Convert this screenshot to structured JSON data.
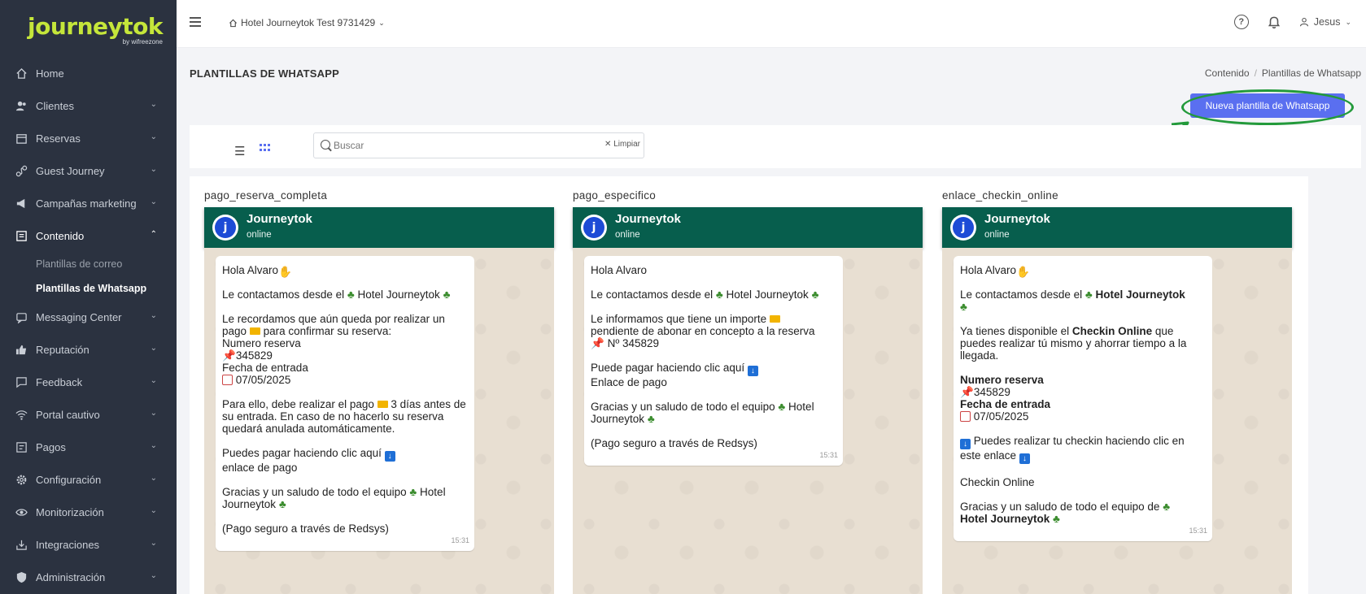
{
  "sidebar": {
    "logo": "journeytok",
    "logo_sub": "by wifreezone",
    "items": [
      {
        "label": "Home"
      },
      {
        "label": "Clientes"
      },
      {
        "label": "Reservas"
      },
      {
        "label": "Guest Journey"
      },
      {
        "label": "Campañas marketing"
      },
      {
        "label": "Contenido"
      },
      {
        "label": "Messaging Center"
      },
      {
        "label": "Reputación"
      },
      {
        "label": "Feedback"
      },
      {
        "label": "Portal cautivo"
      },
      {
        "label": "Pagos"
      },
      {
        "label": "Configuración"
      },
      {
        "label": "Monitorización"
      },
      {
        "label": "Integraciones"
      },
      {
        "label": "Administración"
      }
    ],
    "contenido_sub": [
      {
        "label": "Plantillas de correo"
      },
      {
        "label": "Plantillas de Whatsapp"
      }
    ]
  },
  "topbar": {
    "hotel": "Hotel Journeytok Test 9731429",
    "help_icon": "?",
    "user": "Jesus"
  },
  "header": {
    "title": "PLANTILLAS DE WHATSAPP",
    "breadcrumb_1": "Contenido",
    "breadcrumb_sep": "/",
    "breadcrumb_2": "Plantillas de Whatsapp",
    "new_button": "Nueva plantilla de Whatsapp"
  },
  "toolbar": {
    "search_placeholder": "Buscar",
    "clear_label": "Limpiar"
  },
  "wa": {
    "name": "Journeytok",
    "status": "online",
    "avatar": "j"
  },
  "cards": [
    {
      "name": "pago_reserva_completa",
      "time": "15:31",
      "lines": {
        "l1": "Hola Alvaro",
        "l2a": "Le contactamos desde el",
        "l2b": "Hotel Journeytok",
        "l3a": "Le recordamos que aún queda por realizar un pago",
        "l3b": "para confirmar su reserva:",
        "l3c": "Numero reserva",
        "l3d": "345829",
        "l3e": "Fecha de entrada",
        "l3f": "07/05/2025",
        "l4a": "Para ello, debe realizar el pago",
        "l4b": "3 días antes de su entrada. En caso de no hacerlo su reserva quedará anulada automáticamente.",
        "l5a": "Puedes pagar haciendo clic aquí",
        "l5b": "enlace de pago",
        "l6a": "Gracias y un saludo de todo el equipo",
        "l6b": "Hotel Journeytok",
        "l7": "(Pago seguro a través de Redsys)"
      }
    },
    {
      "name": "pago_especifico",
      "time": "15:31",
      "lines": {
        "l1": "Hola Alvaro",
        "l2a": "Le contactamos desde el",
        "l2b": "Hotel Journeytok",
        "l3a": "Le informamos que tiene un importe",
        "l3b": "pendiente de abonar en concepto a la reserva",
        "l3c": "Nº 345829",
        "l4a": "Puede pagar haciendo clic aquí",
        "l4b": "Enlace de pago",
        "l5a": "Gracias y un saludo de todo el equipo",
        "l5b": "Hotel Journeytok",
        "l6": "(Pago seguro a través de Redsys)"
      }
    },
    {
      "name": "enlace_checkin_online",
      "time": "15:31",
      "lines": {
        "l1": "Hola Alvaro",
        "l2a": "Le contactamos desde el",
        "l2b": "Hotel Journeytok",
        "l3a": "Ya tienes disponible el",
        "l3b": "Checkin Online",
        "l3c": "que puedes realizar tú mismo y ahorrar tiempo a la llegada.",
        "l4a": "Numero reserva",
        "l4b": "345829",
        "l4c": "Fecha de entrada",
        "l4d": "07/05/2025",
        "l5a": "Puedes realizar tu checkin haciendo clic en este enlace",
        "l6": "Checkin Online",
        "l7a": "Gracias y un saludo de todo el equipo de",
        "l7b": "Hotel Journeytok"
      }
    }
  ],
  "colors": {
    "sidebar_bg": "#2b3240",
    "logo_green": "#c5e63a",
    "accent": "#5a6ff0",
    "wa_header": "#075e4d",
    "wa_background": "#e8dfd2",
    "annotation_green": "#239a3b"
  },
  "icons": [
    "home-icon",
    "clients-icon",
    "calendar-icon",
    "guest-journey-icon",
    "megaphone-icon",
    "content-icon",
    "chat-icon",
    "thumbs-up-icon",
    "feedback-icon",
    "wifi-icon",
    "payments-icon",
    "gear-icon",
    "eye-icon",
    "integrations-icon",
    "shield-icon",
    "help-icon",
    "bell-icon",
    "user-icon",
    "search-icon",
    "list-view-icon",
    "grid-view-icon"
  ]
}
